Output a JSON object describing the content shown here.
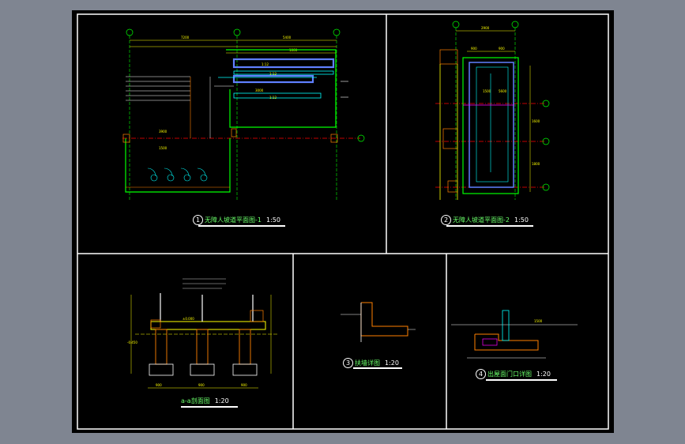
{
  "drawing": {
    "sheet_bg": "#000000",
    "frame_color": "#ffffff",
    "wall_color": "#ffff00",
    "line_green": "#00ff00",
    "line_cyan": "#00ffff",
    "axis_red": "#ff0000",
    "line_magenta": "#ff00ff",
    "hatch_orange": "#ff8000"
  },
  "panels": {
    "p1": {
      "num": "1",
      "title": "无障人坡道平面图-1",
      "scale": "1:50"
    },
    "p2": {
      "num": "2",
      "title": "无障人坡道平面图-2",
      "scale": "1:50"
    },
    "p3": {
      "num": "",
      "title": "a-a剖面图",
      "scale": "1:20"
    },
    "p4": {
      "num": "3",
      "title": "扶墙详图",
      "scale": "1:20"
    },
    "p5": {
      "num": "4",
      "title": "出屋面门口详图",
      "scale": "1:20"
    }
  },
  "axis_bubbles": {
    "p1_top": [
      "②",
      "③",
      "④"
    ],
    "p1_right": [
      "Ⓐ"
    ],
    "p2_top": [
      "⑪",
      "⑫"
    ],
    "p2_right": [
      "Ⓑ",
      "Ⓒ",
      "Ⓓ"
    ]
  },
  "dims": {
    "p1": [
      "7200",
      "5400",
      "1000",
      "3900",
      "1500",
      "3000",
      "1:12",
      "1:12",
      "1:12"
    ],
    "p2": [
      "2900",
      "900",
      "900",
      "1500",
      "1600",
      "1800",
      "5600"
    ],
    "p3": [
      "900",
      "900",
      "900",
      "±0.000",
      "-0.450"
    ],
    "p5": [
      "1500"
    ]
  }
}
